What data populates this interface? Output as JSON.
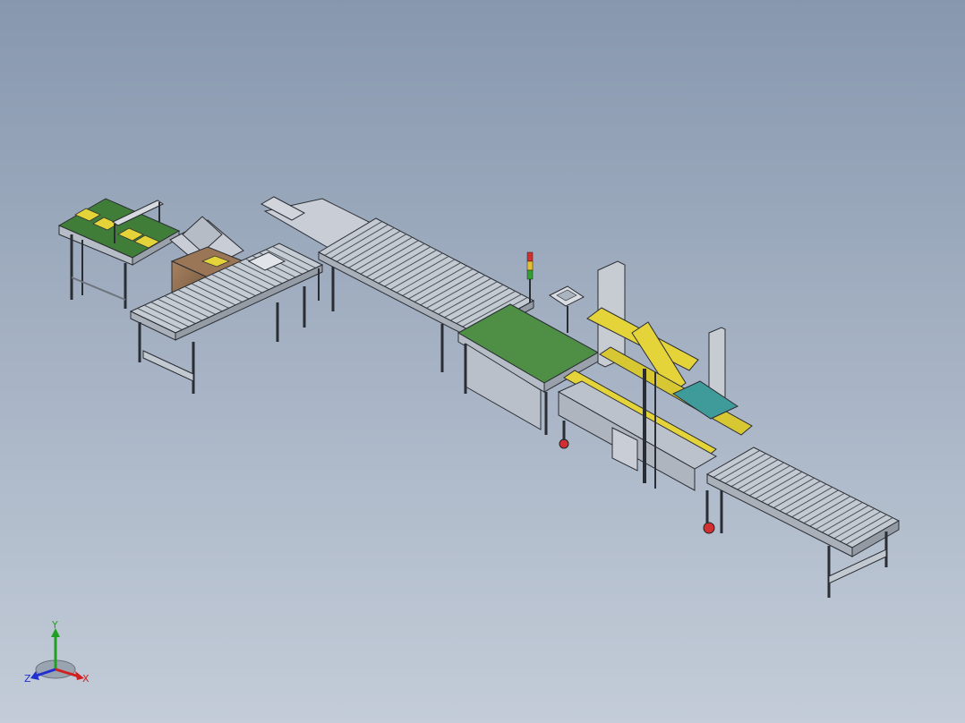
{
  "viewport": {
    "background_top": "#8797ae",
    "background_bottom": "#c3ccd8"
  },
  "colors": {
    "frame": "#c9ced6",
    "frame_dark": "#8f96a0",
    "roller": "#dfe3e8",
    "belt_green": "#4f8f45",
    "yellow": "#e4d43a",
    "box_brown": "#8b6b4f",
    "teal": "#3f9a9a",
    "red": "#d23030",
    "axis_x": "#d02020",
    "axis_y": "#20a020",
    "axis_z": "#2030d0"
  },
  "triad": {
    "x_label": "X",
    "y_label": "Y",
    "z_label": "Z"
  },
  "icons": [
    "coordinate-triad-icon"
  ]
}
